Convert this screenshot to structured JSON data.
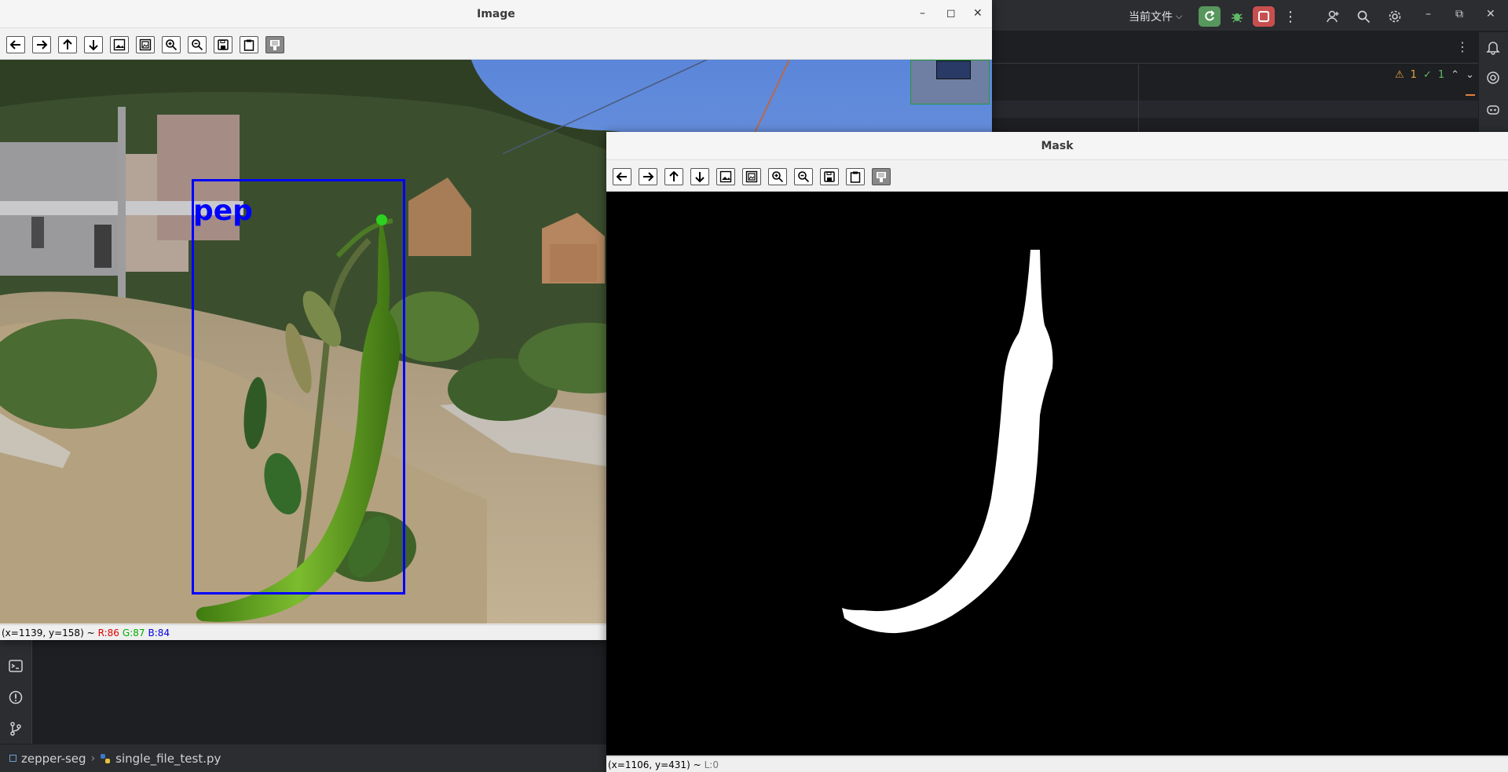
{
  "ide": {
    "run_config": "当前文件",
    "breadcrumb": {
      "project": "zepper-seg",
      "file": "single_file_test.py"
    },
    "problems": {
      "warnings": "1",
      "ok": "1"
    }
  },
  "image_window": {
    "title": "Image",
    "detection_label": "pep",
    "status": {
      "coords": "(x=1139, y=158) ~",
      "r": "R:86",
      "g": "G:87",
      "b": "B:84"
    }
  },
  "mask_window": {
    "title": "Mask",
    "status": {
      "coords": "(x=1106, y=431) ~",
      "l": "L:0"
    }
  },
  "toolbar_buttons": [
    "pan-left",
    "pan-right",
    "pan-up",
    "pan-down",
    "zoom-original",
    "zoom-fit",
    "zoom-in",
    "zoom-out",
    "save",
    "copy-to-clipboard",
    "properties"
  ],
  "colors": {
    "box_blue": "#0000ff",
    "mask_white": "#ffffff",
    "ide_bg": "#1e1f22"
  }
}
